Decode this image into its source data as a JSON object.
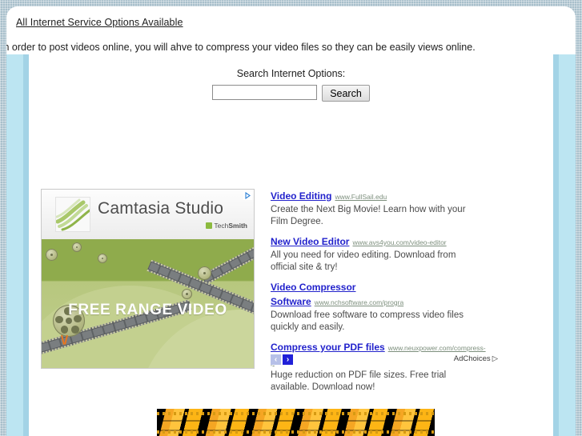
{
  "page": {
    "title_link": "All Internet Service Options Available",
    "intro_text": "In order to post videos online, you will ahve to compress your video files so they can be easily views online."
  },
  "search": {
    "label": "Search Internet Options:",
    "input_value": "",
    "placeholder": "",
    "button_label": "Search"
  },
  "ad_block": {
    "creative": {
      "brand_name": "Camtasia Studio",
      "brand_trademark": "·",
      "brand_sub_light": "Tech",
      "brand_sub_bold": "Smith",
      "headline": "FREE RANGE VIDEO",
      "adchoices_corner_icon": "adchoices-triangle-icon"
    },
    "ads": [
      {
        "title": "Video Editing",
        "url": "www.FullSail.edu",
        "description": "Create the Next Big Movie! Learn how with your Film Degree."
      },
      {
        "title": "New Video Editor",
        "url": "www.avs4you.com/video-editor",
        "description": "All you need for video editing. Download from official site & try!"
      },
      {
        "title": "Video Compressor Software",
        "url": "www.nchsoftware.com/progra",
        "description": "Download free software to compress video files quickly and easily."
      },
      {
        "title": "Compress your PDF files",
        "url": "www.neuxpower.com/compress-p",
        "description": "Huge reduction on PDF file sizes. Free trial available. Download now!"
      }
    ],
    "footer": {
      "prev_arrow": "‹",
      "next_arrow": "›",
      "adchoices_label": "AdChoices",
      "adchoices_triangle": "▷"
    }
  },
  "colors": {
    "page_background": "#a8bfcb",
    "content_background": "#ffffff",
    "side_column": "#bce5f2",
    "side_column_edge": "#a3d3e6",
    "ad_title_link": "#2222cc",
    "ad_url": "#7d8f7d",
    "ad_next_arrow": "#2020d8",
    "ad_prev_arrow": "#b6c0e8",
    "banner_orange": "#fdb515",
    "banner_black": "#000000"
  }
}
